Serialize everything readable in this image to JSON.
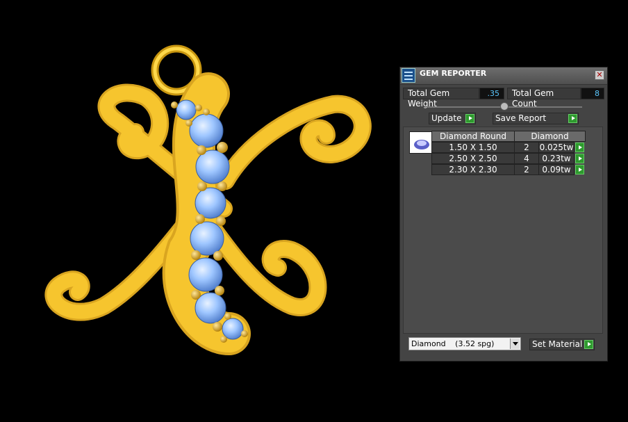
{
  "panel": {
    "title": "GEM REPORTER",
    "close_glyph": "✕",
    "icon": "gem-reporter-icon",
    "total_gem_weight_label": "Total Gem Weight",
    "total_gem_weight_value": ".35",
    "total_gem_count_label": "Total Gem Count",
    "total_gem_count_value": "8",
    "update_label": "Update",
    "save_report_label": "Save Report",
    "table": {
      "headers": [
        "Diamond Round",
        "Diamond"
      ],
      "rows": [
        {
          "size": "1.50 X 1.50",
          "count": "2",
          "weight": "0.025tw"
        },
        {
          "size": "2.50 X 2.50",
          "count": "4",
          "weight": "0.23tw"
        },
        {
          "size": "2.30 X 2.30",
          "count": "2",
          "weight": "0.09tw"
        }
      ]
    },
    "material_select": {
      "value": "Diamond",
      "spg": "(3.52 spg)"
    },
    "set_material_label": "Set Material",
    "accent_color": "#2e9a2e",
    "value_color": "#5cc8ff"
  },
  "viewport": {
    "description_icon": "pendant-3d-icon",
    "metal_color": "#f2c230",
    "gem_color": "#9ec6ff"
  }
}
